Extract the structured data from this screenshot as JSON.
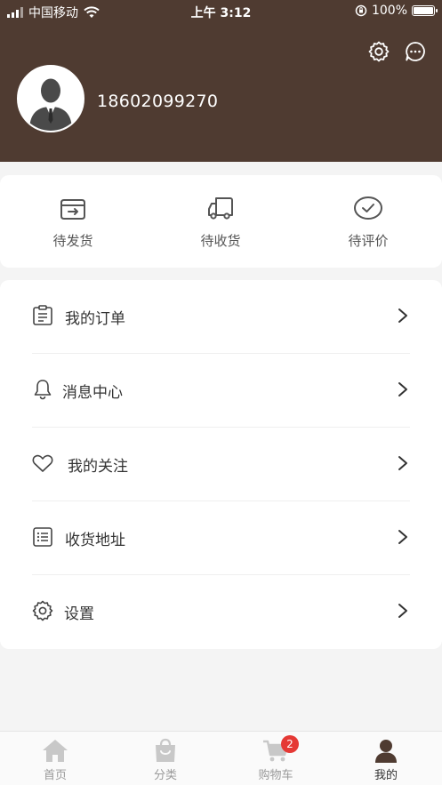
{
  "status_bar": {
    "carrier": "中国移动",
    "time": "上午 3:12",
    "battery": "100%"
  },
  "header": {
    "phone": "18602099270",
    "settings_icon": "gear-icon",
    "message_icon": "chat-bubble-icon",
    "colors": {
      "background": "#4f3b31"
    }
  },
  "orders": [
    {
      "label": "待发货",
      "icon": "box-arrow-icon"
    },
    {
      "label": "待收货",
      "icon": "truck-icon"
    },
    {
      "label": "待评价",
      "icon": "check-circle-icon"
    }
  ],
  "menu": [
    {
      "label": "我的订单",
      "icon": "clipboard-icon"
    },
    {
      "label": "消息中心",
      "icon": "bell-icon"
    },
    {
      "label": "我的关注",
      "icon": "heart-icon"
    },
    {
      "label": "收货地址",
      "icon": "list-icon"
    },
    {
      "label": "设置",
      "icon": "gear-icon"
    }
  ],
  "tabbar": [
    {
      "label": "首页",
      "icon": "home-icon"
    },
    {
      "label": "分类",
      "icon": "bag-icon"
    },
    {
      "label": "购物车",
      "icon": "cart-icon",
      "badge": "2"
    },
    {
      "label": "我的",
      "icon": "user-icon",
      "active": true
    }
  ]
}
